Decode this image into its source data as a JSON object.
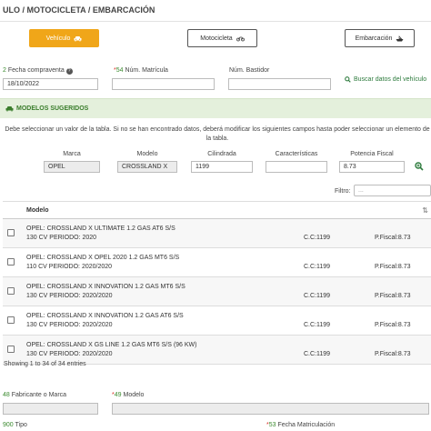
{
  "page": {
    "title": "ULO / MOTOCICLETA / EMBARCACIÓN"
  },
  "vehicle_types": [
    {
      "label": "Vehículo",
      "icon": "car-icon",
      "active": true
    },
    {
      "label": "Motocicleta",
      "icon": "motorcycle-icon",
      "active": false
    },
    {
      "label": "Embarcación",
      "icon": "boat-icon",
      "active": false
    }
  ],
  "fields": {
    "fecha": {
      "num": "2",
      "label": "Fecha compraventa",
      "value": "18/10/2022"
    },
    "matricula": {
      "num": "54",
      "label": "Núm. Matrícula",
      "value": ""
    },
    "bastidor": {
      "label": "Núm. Bastidor",
      "value": ""
    }
  },
  "buscar_link": "Buscar datos del vehículo",
  "suggested": {
    "title": "MODELOS SUGERIDOS",
    "info": "Debe seleccionar un valor de la tabla. Si no se han encontrado datos, deberá modificar los siguientes campos hasta poder seleccionar un elemento de la tabla.",
    "columns": [
      "Marca",
      "Modelo",
      "Cilindrada",
      "Características",
      "Potencia Fiscal"
    ],
    "values": [
      "OPEL",
      "CROSSLAND X",
      "1199",
      "",
      "8.73"
    ]
  },
  "filter": {
    "label": "Filtro:",
    "placeholder": "..."
  },
  "table": {
    "header": "Modelo",
    "rows": [
      {
        "model": "OPEL: CROSSLAND X ULTIMATE 1.2 GAS AT6 S/S",
        "detail": "130 CV PERIODO: 2020",
        "cc": "C.C:1199",
        "pf": "P.Fiscal:8.73"
      },
      {
        "model": "OPEL: CROSSLAND X OPEL 2020 1.2 GAS MT6 S/S",
        "detail": "110 CV PERIODO: 2020/2020",
        "cc": "C.C:1199",
        "pf": "P.Fiscal:8.73"
      },
      {
        "model": "OPEL: CROSSLAND X INNOVATION 1.2 GAS MT6 S/S",
        "detail": "130 CV PERIODO: 2020/2020",
        "cc": "C.C:1199",
        "pf": "P.Fiscal:8.73"
      },
      {
        "model": "OPEL: CROSSLAND X INNOVATION 1.2 GAS AT6 S/S",
        "detail": "130 CV PERIODO: 2020/2020",
        "cc": "C.C:1199",
        "pf": "P.Fiscal:8.73"
      },
      {
        "model": "OPEL: CROSSLAND X GS LINE 1.2 GAS MT6 S/S (96 KW)",
        "detail": "130 CV PERIODO: 2020/2020",
        "cc": "C.C:1199",
        "pf": "P.Fiscal:8.73"
      }
    ],
    "showing": "Showing 1 to 34 of 34 entries"
  },
  "bottom_fields": {
    "fabricante": {
      "num": "48",
      "label": "Fabricante o Marca"
    },
    "modelo": {
      "num": "49",
      "label": "Modelo"
    },
    "tipo": {
      "num": "900",
      "label": "Tipo"
    },
    "fecha_matriculacion": {
      "num": "53",
      "label": "Fecha Matriculación"
    }
  },
  "colors": {
    "accent": "#f0a619",
    "green": "#3a8a2e",
    "section_bg": "#e4f0dc",
    "required": "#d93025"
  }
}
